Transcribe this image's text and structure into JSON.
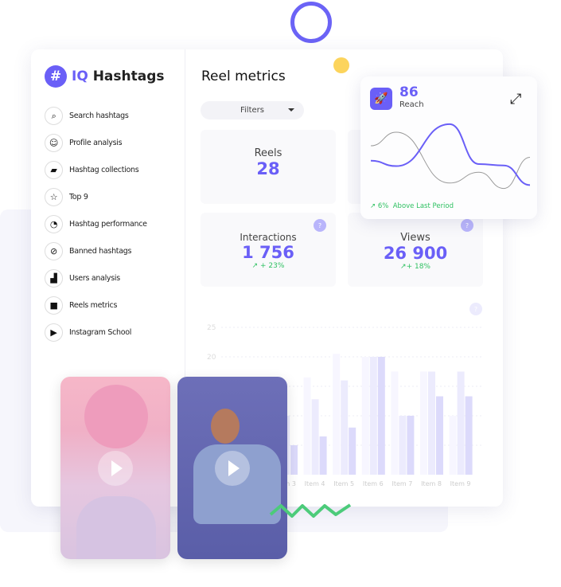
{
  "app": {
    "logo_symbol": "#",
    "brand_prefix": "IQ",
    "brand_name": "Hashtags",
    "accent": "#6a5ff7"
  },
  "sidebar": {
    "items": [
      {
        "label": "Search hashtags",
        "icon": "search-icon"
      },
      {
        "label": "Profile analysis",
        "icon": "face-icon"
      },
      {
        "label": "Hashtag collections",
        "icon": "folder-icon"
      },
      {
        "label": "Top 9",
        "icon": "star-icon"
      },
      {
        "label": "Hashtag performance",
        "icon": "gauge-icon"
      },
      {
        "label": "Banned hashtags",
        "icon": "ban-icon"
      },
      {
        "label": "Users analysis",
        "icon": "bar-chart-icon"
      },
      {
        "label": "Reels metrics",
        "icon": "video-icon"
      },
      {
        "label": "Instagram School",
        "icon": "play-box-icon"
      }
    ]
  },
  "main": {
    "title": "Reel metrics",
    "filters_label": "Filters",
    "cards": [
      {
        "label": "Reels",
        "value": "28"
      },
      {
        "label": "Interactions",
        "value": "1 756",
        "change": "+ 23%",
        "help": "?"
      },
      {
        "label": "Views",
        "value": "26 900",
        "change": "+ 18%",
        "help": "?"
      }
    ],
    "chart_help": "?"
  },
  "reach_popup": {
    "value": "86",
    "label": "Reach",
    "change": "6%",
    "change_text": "Above Last Period",
    "colors": {
      "primary": "#6a5ff7",
      "secondary": "#9a9a9a"
    },
    "sparkline": {
      "primary": [
        45,
        37,
        99,
        40,
        38,
        9
      ],
      "secondary": [
        67,
        87,
        12,
        28,
        4,
        50
      ]
    }
  },
  "chart_data": {
    "type": "bar",
    "categories": [
      "Item 3",
      "Item 4",
      "Item 5",
      "Item 6",
      "Item 7",
      "Item 8",
      "Item 9"
    ],
    "series": [
      {
        "values": [
          10,
          16.5,
          20.5,
          20,
          17.5,
          17.5,
          10
        ]
      },
      {
        "values": [
          10,
          12.8,
          16,
          20,
          10,
          17.5,
          17.5
        ]
      },
      {
        "values": [
          5,
          6.5,
          8,
          20,
          10,
          13.3,
          13.3
        ]
      }
    ],
    "yticks": [
      "25",
      "20"
    ],
    "ylim": [
      0,
      25
    ],
    "grid": true,
    "colors": [
      "#f7f6ff",
      "#ecebfd",
      "#dcdafb"
    ]
  }
}
